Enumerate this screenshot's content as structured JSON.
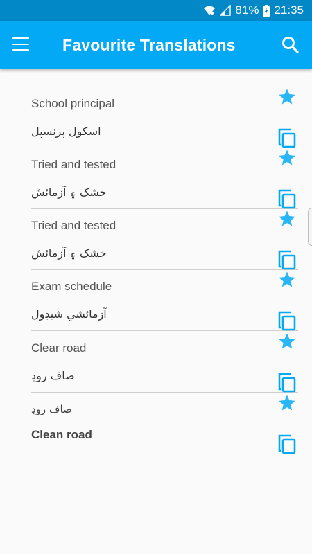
{
  "status_bar": {
    "battery": "81%",
    "time": "21:35"
  },
  "app_bar": {
    "title": "Favourite Translations"
  },
  "colors": {
    "primary": "#03a9f4",
    "primary_dark": "#0288c7",
    "star": "#29b6f6",
    "copy_icon": "#03a9f4"
  },
  "items": [
    {
      "source": "School principal",
      "translation": "اسکول پرنسپل"
    },
    {
      "source": "Tried and tested",
      "translation": "خشک ۽ آزمائش"
    },
    {
      "source": "Tried and tested",
      "translation": "خشک ۽ آزمائش"
    },
    {
      "source": "Exam schedule",
      "translation": "آزمائشي شيڊول"
    },
    {
      "source": "Clear road",
      "translation": "صاف روڊ"
    },
    {
      "source": "صاف روڊ",
      "translation": "Clean road"
    }
  ]
}
